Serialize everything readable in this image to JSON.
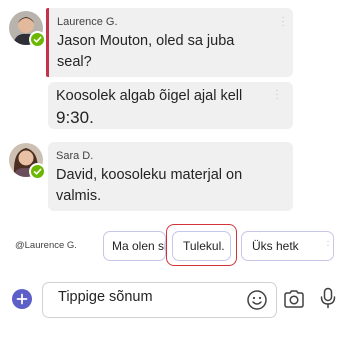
{
  "messages": [
    {
      "sender": "Laurence G.",
      "text": "Jason Mouton, oled sa juba seal?",
      "urgent": true
    },
    {
      "text": "Koosolek algab õigel ajal kell",
      "time": "9:30."
    },
    {
      "sender": "Sara D.",
      "text": "David, koosoleku materjal on valmis."
    }
  ],
  "suggested_replies": {
    "mention": "@Laurence G.",
    "chips": [
      "Ma olen siin.",
      "Tulekul.",
      "Üks hetk"
    ],
    "highlighted_index": 1
  },
  "compose": {
    "placeholder": "Tippige sõnum"
  },
  "icons": {
    "add": "add-icon",
    "emoji": "emoji-icon",
    "camera": "camera-icon",
    "microphone": "microphone-icon"
  },
  "colors": {
    "accent": "#5b5fc7",
    "urgent_bar": "#c4314b",
    "presence_available": "#6bb700",
    "highlight_box": "#d13438"
  }
}
